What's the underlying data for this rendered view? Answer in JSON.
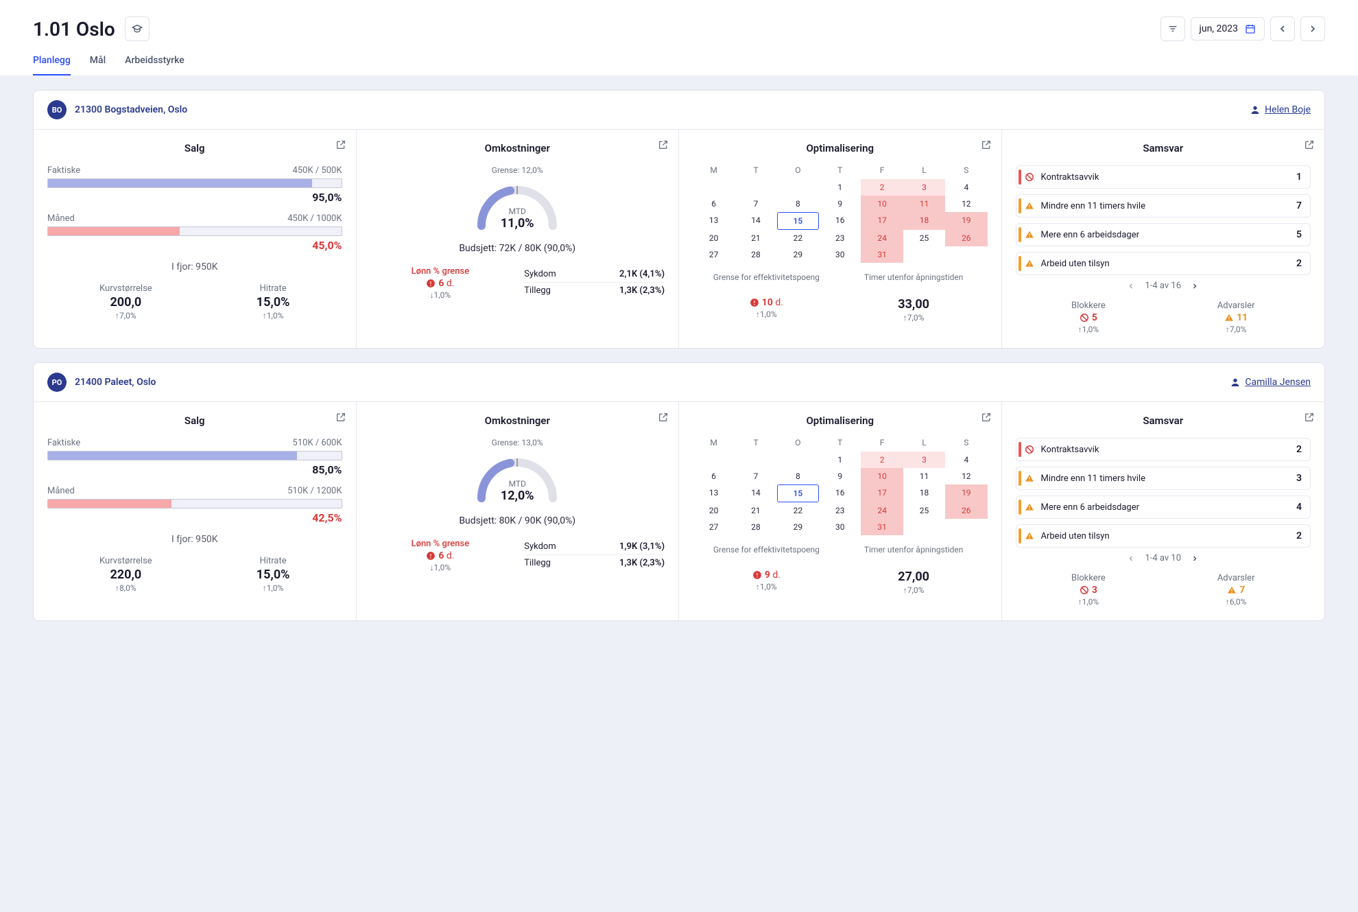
{
  "header": {
    "title": "1.01 Oslo",
    "date": "jun, 2023"
  },
  "tabs": [
    {
      "id": "planlegg",
      "label": "Planlegg",
      "active": true
    },
    {
      "id": "mal",
      "label": "Mål",
      "active": false
    },
    {
      "id": "arbeidsstyrke",
      "label": "Arbeidsstyrke",
      "active": false
    }
  ],
  "labels": {
    "salg": "Salg",
    "omkostninger": "Omkostninger",
    "optimalisering": "Optimalisering",
    "samsvar": "Samsvar",
    "faktiske": "Faktiske",
    "maned": "Måned",
    "ifjor": "I fjor: 950K",
    "kurvstorrelse": "Kurvstørrelse",
    "hitrate": "Hitrate",
    "grense": "Grense:",
    "mtd": "MTD",
    "budsjett": "Budsjett:",
    "lonn_grense": "Lønn % grense",
    "sykdom": "Sykdom",
    "tillegg": "Tillegg",
    "blokkere": "Blokkere",
    "advarsler": "Advarsler",
    "grense_eff": "Grense for effektivitetspoeng",
    "timer_utenfor": "Timer utenfor åpningstiden",
    "pager_av": "av",
    "days_suffix": "d."
  },
  "cal_days": [
    "M",
    "T",
    "O",
    "T",
    "F",
    "L",
    "S"
  ],
  "stores": [
    {
      "badge": "BO",
      "name": "21300 Bogstadveien, Oslo",
      "user": "Helen Boje",
      "salg": {
        "faktiske_vals": "450K / 500K",
        "faktiske_pct": "95,0%",
        "faktiske_fill": 90,
        "maned_vals": "450K / 1000K",
        "maned_pct": "45,0%",
        "maned_fill": 45,
        "kurv": "200,0",
        "kurv_delta": "↑7,0%",
        "hitrate": "15,0%",
        "hitrate_delta": "↑1,0%"
      },
      "omk": {
        "grense": "12,0%",
        "mtd": "11,0%",
        "budsjett": "72K / 80K (90,0%)",
        "lonn_days": "6",
        "lonn_delta": "↓1,0%",
        "sykdom": "2,1K (4,1%)",
        "tillegg": "1,3K (2,3%)"
      },
      "opt": {
        "eff_days": "10",
        "eff_delta": "↑1,0%",
        "timer": "33,00",
        "timer_delta": "↑7,0%",
        "cal": [
          [
            null,
            null,
            null,
            "1",
            "2h",
            "3h",
            "4"
          ],
          [
            "6",
            "7",
            "8",
            "9",
            "10s",
            "11s",
            "12"
          ],
          [
            "13",
            "14",
            "15t",
            "16",
            "17s",
            "18s",
            "19s"
          ],
          [
            "20",
            "21",
            "22",
            "23",
            "24s",
            "25",
            "26s"
          ],
          [
            "27",
            "28",
            "29",
            "30",
            "31s",
            null,
            null
          ]
        ]
      },
      "samsvar": {
        "items": [
          {
            "type": "red",
            "label": "Kontraktsavvik",
            "count": "1"
          },
          {
            "type": "orange",
            "label": "Mindre enn 11 timers hvile",
            "count": "7"
          },
          {
            "type": "orange",
            "label": "Mere enn 6 arbeidsdager",
            "count": "5"
          },
          {
            "type": "orange",
            "label": "Arbeid uten tilsyn",
            "count": "2"
          }
        ],
        "pager": "1-4",
        "total": "16",
        "blokkere": "5",
        "blokkere_delta": "↑1,0%",
        "advarsler": "11",
        "advarsler_delta": "↑7,0%"
      }
    },
    {
      "badge": "PO",
      "name": "21400 Paleet, Oslo",
      "user": "Camilla Jensen",
      "salg": {
        "faktiske_vals": "510K / 600K",
        "faktiske_pct": "85,0%",
        "faktiske_fill": 85,
        "maned_vals": "510K / 1200K",
        "maned_pct": "42,5%",
        "maned_fill": 42,
        "kurv": "220,0",
        "kurv_delta": "↑8,0%",
        "hitrate": "15,0%",
        "hitrate_delta": "↑1,0%"
      },
      "omk": {
        "grense": "13,0%",
        "mtd": "12,0%",
        "budsjett": "80K / 90K (90,0%)",
        "lonn_days": "6",
        "lonn_delta": "↓1,0%",
        "sykdom": "1,9K (3,1%)",
        "tillegg": "1,3K (2,3%)"
      },
      "opt": {
        "eff_days": "9",
        "eff_delta": "↑1,0%",
        "timer": "27,00",
        "timer_delta": "↑7,0%",
        "cal": [
          [
            null,
            null,
            null,
            "1",
            "2h",
            "3h",
            "4"
          ],
          [
            "6",
            "7",
            "8",
            "9",
            "10s",
            "11",
            "12"
          ],
          [
            "13",
            "14",
            "15t",
            "16",
            "17s",
            "18",
            "19s"
          ],
          [
            "20",
            "21",
            "22",
            "23",
            "24s",
            "25",
            "26s"
          ],
          [
            "27",
            "28",
            "29",
            "30",
            "31s",
            null,
            null
          ]
        ]
      },
      "samsvar": {
        "items": [
          {
            "type": "red",
            "label": "Kontraktsavvik",
            "count": "2"
          },
          {
            "type": "orange",
            "label": "Mindre enn 11 timers hvile",
            "count": "3"
          },
          {
            "type": "orange",
            "label": "Mere enn 6 arbeidsdager",
            "count": "4"
          },
          {
            "type": "orange",
            "label": "Arbeid uten tilsyn",
            "count": "2"
          }
        ],
        "pager": "1-4",
        "total": "10",
        "blokkere": "3",
        "blokkere_delta": "↑1,0%",
        "advarsler": "7",
        "advarsler_delta": "↑6,0%"
      }
    }
  ]
}
